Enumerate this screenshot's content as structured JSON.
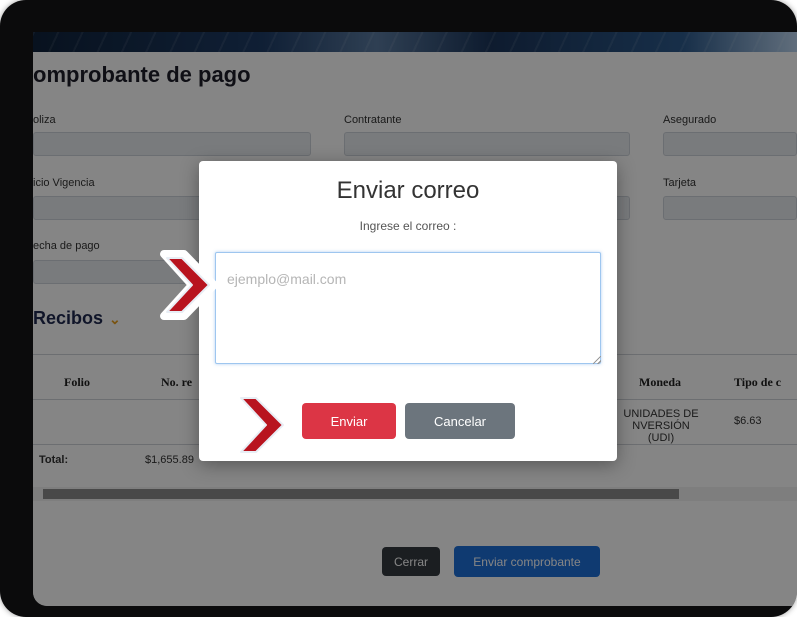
{
  "page": {
    "title": "omprobante de pago",
    "fields": {
      "poliza_label": "oliza",
      "contratante_label": "Contratante",
      "asegurado_label": "Asegurado",
      "inicio_vigencia_label": "icio Vigencia",
      "tarjeta_label": "Tarjeta",
      "fecha_pago_label": "echa de pago"
    }
  },
  "receipts": {
    "section_title": "Recibos",
    "columns": [
      "Folio",
      "No. re",
      "Moneda",
      "Tipo de c"
    ],
    "row": {
      "moneda_line1": "UNIDADES DE",
      "moneda_line2": "NVERSIÓN (UDI)",
      "tipo_cambio": "$6.63"
    },
    "total_label": "Total:",
    "total_value": "$1,655.89"
  },
  "footer": {
    "close_label": "Cerrar",
    "send_receipt_label": "Enviar comprobante"
  },
  "modal": {
    "title": "Enviar correo",
    "subtitle": "Ingrese el correo :",
    "email_placeholder": "ejemplo@mail.com",
    "send_label": "Enviar",
    "cancel_label": "Cancelar"
  },
  "colors": {
    "send_button": "#dc3545",
    "cancel_button": "#6c757d",
    "close_button": "#343a40",
    "send_receipt_button": "#1e6fd9",
    "arrow_fill": "#b8141f"
  },
  "icons": {
    "section_chevron": "chevron-down-icon",
    "annotation_arrows": "chevron-right-icon"
  }
}
